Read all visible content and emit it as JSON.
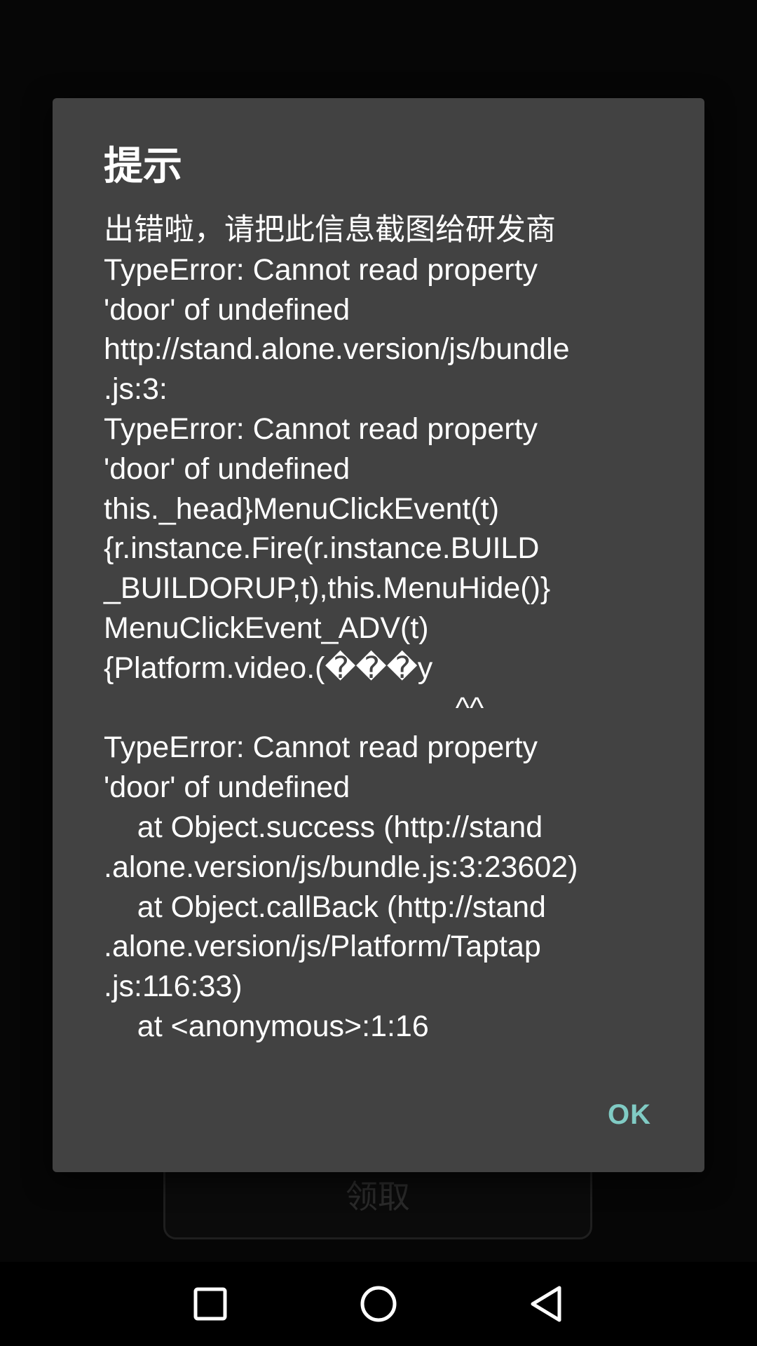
{
  "dialog": {
    "title": "提示",
    "message_lines": [
      "出错啦，请把此信息截图给研发商",
      "TypeError: Cannot read property",
      "'door' of undefined",
      "http://stand.alone.version/js/bundle",
      ".js:3:",
      "TypeError: Cannot read property",
      "'door' of undefined",
      "this._head}MenuClickEvent(t)",
      "{r.instance.Fire(r.instance.BUILD",
      "_BUILDORUP,t),this.MenuHide()}",
      "MenuClickEvent_ADV(t)",
      "{Platform.video.(���y",
      "                                          ^^",
      "TypeError: Cannot read property",
      "'door' of undefined",
      "    at Object.success (http://stand",
      ".alone.version/js/bundle.js:3:23602)",
      "    at Object.callBack (http://stand",
      ".alone.version/js/Platform/Taptap",
      ".js:116:33)",
      "    at <anonymous>:1:16"
    ],
    "ok_label": "OK"
  },
  "background": {
    "title_text": "",
    "button_label": "领取"
  },
  "colors": {
    "dialog_bg": "#424242",
    "accent": "#80cbc4",
    "text": "#ffffff",
    "scrim": "#060606"
  },
  "navbar": {
    "icons": [
      "recents-icon",
      "home-icon",
      "back-icon"
    ]
  }
}
